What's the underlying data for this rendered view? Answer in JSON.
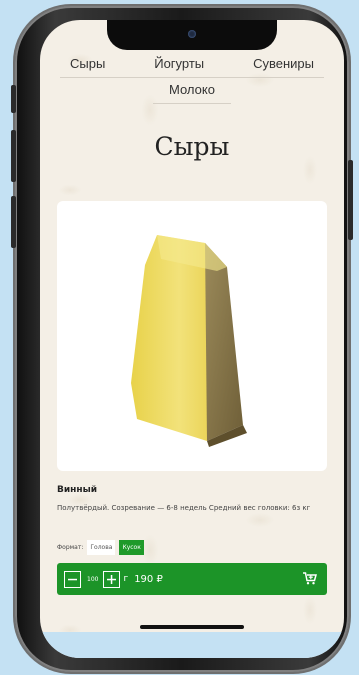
{
  "nav": {
    "items": [
      "Сыры",
      "Йогурты",
      "Сувениры"
    ],
    "second_row": "Молоко"
  },
  "page": {
    "title": "Сыры"
  },
  "product": {
    "name": "Винный",
    "description": "Полутвёрдый. Созревание — 6-8 недель Средний вес головки: 6з кг",
    "format_label": "Формат:",
    "formats": [
      "Голова",
      "Кусок"
    ],
    "selected_format": "Кусок",
    "quantity": "100",
    "unit": "г",
    "price": "190 ₽"
  },
  "icons": {
    "minus": "minus-icon",
    "plus": "plus-icon",
    "cart": "add-to-cart-icon"
  },
  "colors": {
    "accent": "#1c9428",
    "background": "#f4efe6",
    "outer": "#c4e1f3"
  }
}
